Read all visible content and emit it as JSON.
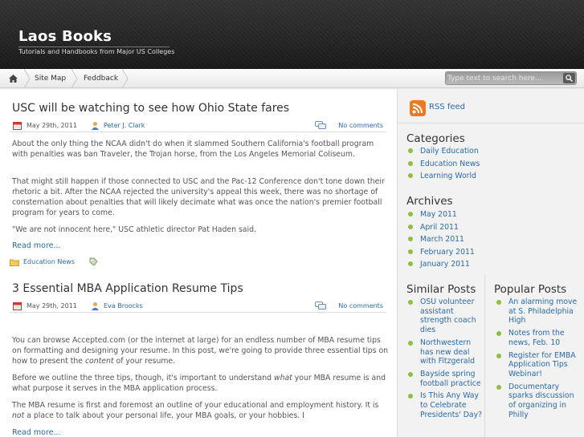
{
  "site": {
    "title": "Laos Books",
    "tagline": "Tutorials and Handbooks from Major US Colleges"
  },
  "nav": {
    "home_icon": "home-icon",
    "items": [
      "Site Map",
      "Feddback"
    ],
    "search_placeholder": "Type text to search here...",
    "search_icon": "search-icon"
  },
  "posts": [
    {
      "title": "USC will be watching to see how Ohio State fares",
      "date": "May 29th, 2011",
      "author": "Peter J. Clark",
      "comments": "No comments",
      "paragraphs": [
        "About the only thing the NCAA didn't do when it slammed Southern California's football program with penalties was ban Traveler, the Trojan horse, from the Los Angeles Memorial Coliseum.",
        "That might still happen if those connected to USC and the Pac-12 Conference don't tone down their rhetoric a bit. After the NCAA rejected the university's appeal this week, there was no shortage of consternation about penalties that will likely decimate what was once the nation's premier football program for years to come.",
        "\"We are not innocent here,\" USC athletic director Pat Haden said."
      ],
      "read_more": "Read more...",
      "category": "Education News"
    },
    {
      "title": "3 Essential MBA Application Resume Tips",
      "date": "May 29th, 2011",
      "author": "Eva Broocks",
      "comments": "No comments",
      "p1_a": "You can browse Accepted.com (or the internet at large) for an endless number of MBA resume tips on formatting and designing your resume. In this post, we're going to provide three essential tips on how to present the ",
      "p1_em": "content",
      "p1_b": " of your resume.",
      "p2_a": "Before we outline the three tips, though, it's important to understand ",
      "p2_em": "what",
      "p2_b": " your MBA resume is and what purpose it serves in the MBA application process.",
      "p3_a": "The MBA resume is first and foremost an outline of your educational and employment history. It is ",
      "p3_em": "not",
      "p3_b": " a place to talk about your personal life, your MBA goals, or your hobbies. I",
      "read_more": "Read more..."
    }
  ],
  "sidebar": {
    "rss": "RSS feed",
    "categories_title": "Categories",
    "categories": [
      "Daily Education",
      "Education News",
      "Learning World"
    ],
    "archives_title": "Archives",
    "archives": [
      "May 2011",
      "April 2011",
      "March 2011",
      "February 2011",
      "January 2011"
    ],
    "similar_title": "Similar Posts",
    "similar": [
      "OSU volunteer assistant strength coach dies",
      "Northwestern has new deal with Fitzgerald",
      "Bayside spring football practice",
      "Is This Any Way to Celebrate Presidents' Day?"
    ],
    "popular_title": "Popular Posts",
    "popular": [
      "An alarming move at S. Philadelphia High",
      "Notes from the news, Feb. 10",
      "Register for EMBA Application Tips Webinar!",
      "Documentary sparks discussion of organizing in Philly"
    ]
  },
  "colors": {
    "link": "#2a6aa8",
    "bullet": "#8fbf3c",
    "rss": "#e46c1b"
  }
}
